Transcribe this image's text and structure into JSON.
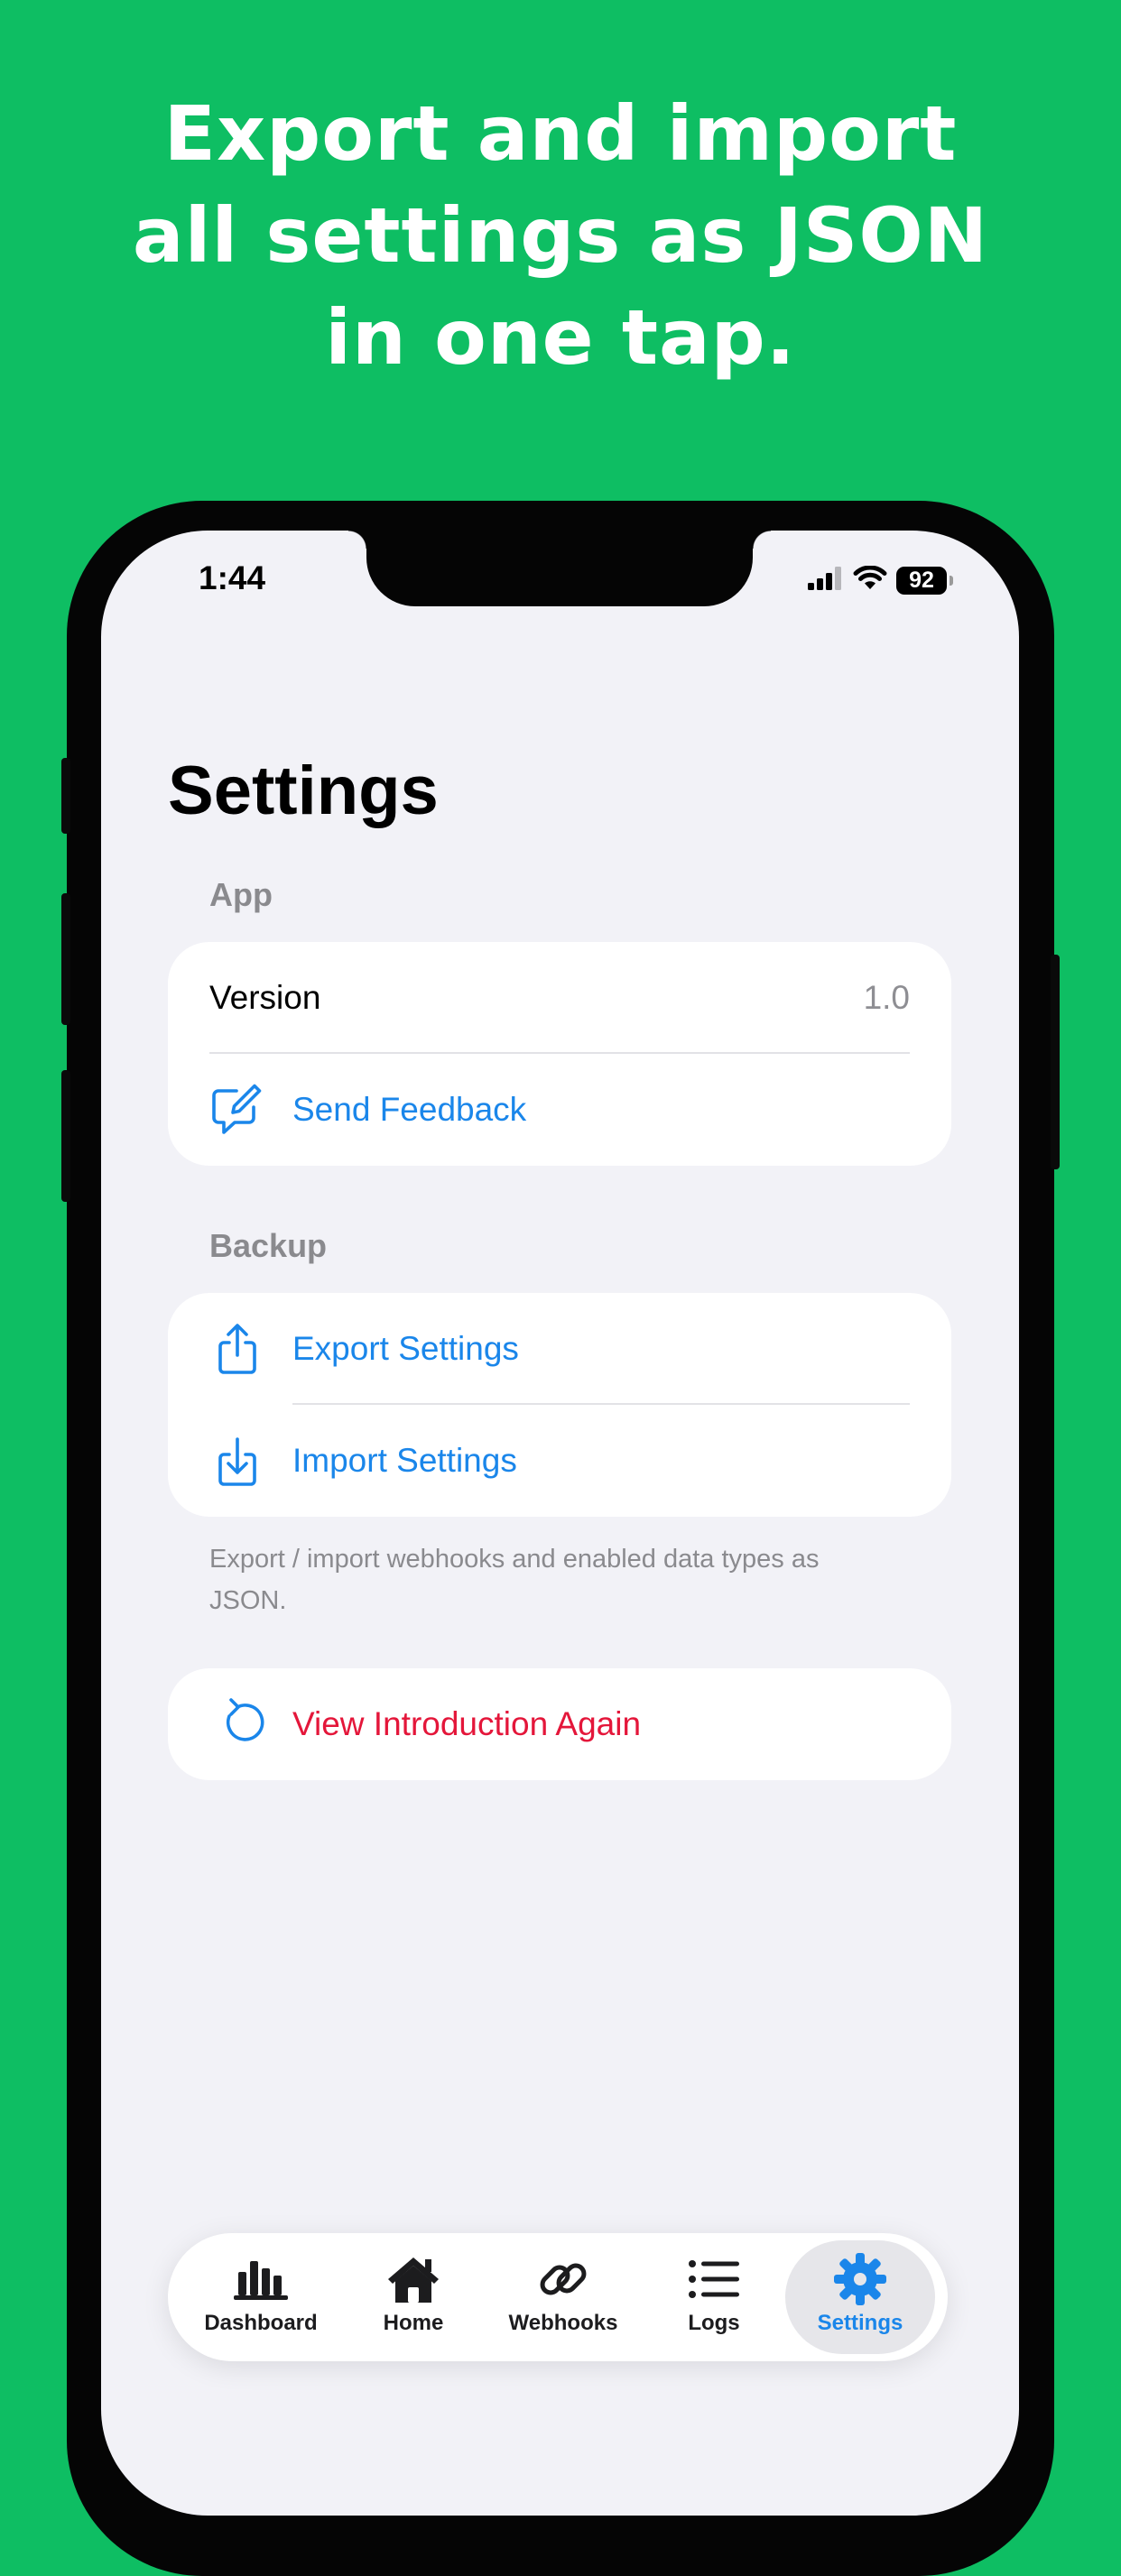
{
  "headline": {
    "line1": "Export and import",
    "line2": "all settings as JSON",
    "line3": "in one tap."
  },
  "status_bar": {
    "time": "1:44",
    "battery": "92",
    "icons": [
      "cellular-signal-icon",
      "wifi-icon",
      "battery-icon"
    ]
  },
  "page": {
    "title": "Settings"
  },
  "sections": {
    "app": {
      "header": "App",
      "version_label": "Version",
      "version_value": "1.0",
      "feedback_label": "Send Feedback"
    },
    "backup": {
      "header": "Backup",
      "export_label": "Export Settings",
      "import_label": "Import Settings",
      "footer": "Export / import webhooks and enabled data types as JSON."
    },
    "intro": {
      "label": "View Introduction Again"
    }
  },
  "tab_bar": {
    "items": [
      {
        "label": "Dashboard",
        "icon": "bar-chart-icon"
      },
      {
        "label": "Home",
        "icon": "home-icon"
      },
      {
        "label": "Webhooks",
        "icon": "link-icon"
      },
      {
        "label": "Logs",
        "icon": "list-icon"
      },
      {
        "label": "Settings",
        "icon": "gear-icon",
        "selected": true
      }
    ]
  },
  "colors": {
    "background": "#0ebe63",
    "accent": "#1a86ea",
    "destructive": "#e4163a"
  }
}
